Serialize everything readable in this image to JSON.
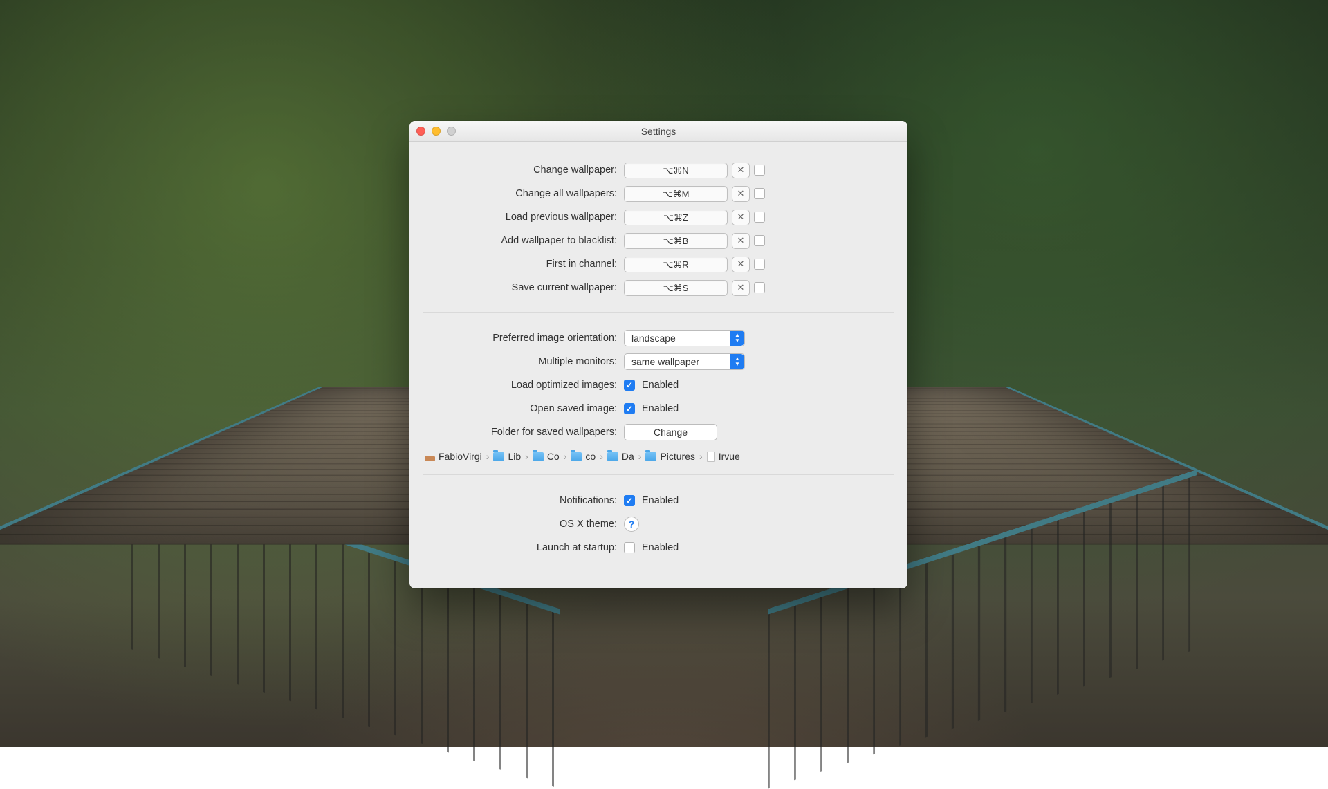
{
  "window": {
    "title": "Settings"
  },
  "shortcuts": [
    {
      "label": "Change wallpaper:",
      "keys": "⌥⌘N"
    },
    {
      "label": "Change all wallpapers:",
      "keys": "⌥⌘M"
    },
    {
      "label": "Load previous wallpaper:",
      "keys": "⌥⌘Z"
    },
    {
      "label": "Add wallpaper to blacklist:",
      "keys": "⌥⌘B"
    },
    {
      "label": "First in channel:",
      "keys": "⌥⌘R"
    },
    {
      "label": "Save current wallpaper:",
      "keys": "⌥⌘S"
    }
  ],
  "image": {
    "orientation_label": "Preferred image orientation:",
    "orientation_value": "landscape",
    "monitors_label": "Multiple monitors:",
    "monitors_value": "same wallpaper",
    "optimized_label": "Load optimized images:",
    "open_saved_label": "Open saved image:",
    "folder_label": "Folder for saved wallpapers:",
    "change_button": "Change",
    "enabled_text": "Enabled"
  },
  "path": [
    {
      "icon": "home",
      "text": "FabioVirgi"
    },
    {
      "icon": "folder",
      "text": "Lib"
    },
    {
      "icon": "folder",
      "text": "Co"
    },
    {
      "icon": "folder",
      "text": "co"
    },
    {
      "icon": "folder",
      "text": "Da"
    },
    {
      "icon": "folder",
      "text": "Pictures"
    },
    {
      "icon": "file",
      "text": "Irvue"
    }
  ],
  "system": {
    "notifications_label": "Notifications:",
    "theme_label": "OS X theme:",
    "startup_label": "Launch at startup:",
    "enabled_text": "Enabled"
  }
}
